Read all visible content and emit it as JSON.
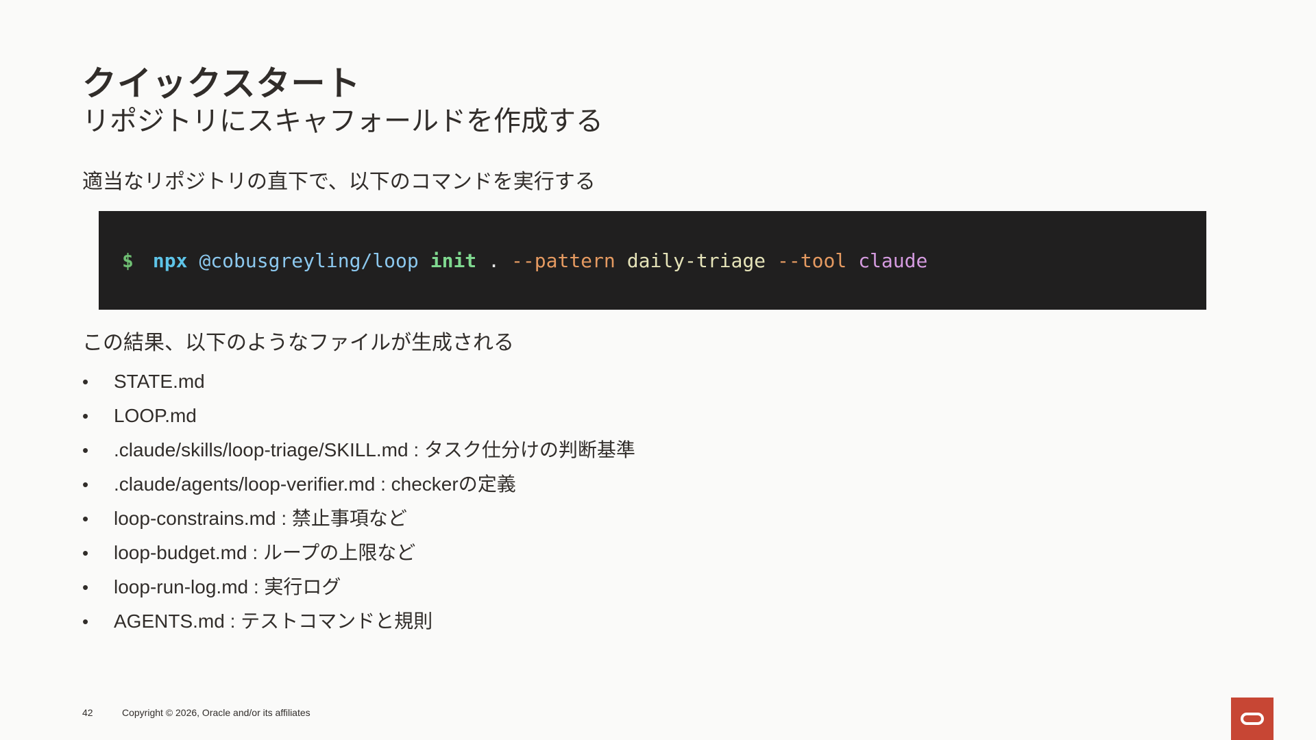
{
  "slide": {
    "title": "クイックスタート",
    "subtitle": "リポジトリにスキャフォールドを作成する",
    "intro": "適当なリポジトリの直下で、以下のコマンドを実行する",
    "result_intro": "この結果、以下のようなファイルが生成される"
  },
  "command": {
    "prompt": "$",
    "npx": "npx",
    "package": "@cobusgreyling/loop",
    "subcommand": "init",
    "target": ".",
    "pattern_flag": "--pattern",
    "pattern_value": "daily-triage",
    "tool_flag": "--tool",
    "tool_value": "claude"
  },
  "files": [
    "STATE.md",
    "LOOP.md",
    ".claude/skills/loop-triage/SKILL.md : タスク仕分けの判断基準",
    ".claude/agents/loop-verifier.md : checkerの定義",
    "loop-constrains.md : 禁止事項など",
    "loop-budget.md : ループの上限など",
    "loop-run-log.md : 実行ログ",
    "AGENTS.md : テストコマンドと規則"
  ],
  "bullet_char": "•",
  "footer": {
    "page_number": "42",
    "copyright": "Copyright © 2026, Oracle and/or its affiliates"
  },
  "colors": {
    "background": "#fafaf9",
    "code_background": "#201f1f",
    "brand_red": "#c74634",
    "text": "#312d2a"
  },
  "icons": {
    "logo": "oracle-logo-icon"
  }
}
